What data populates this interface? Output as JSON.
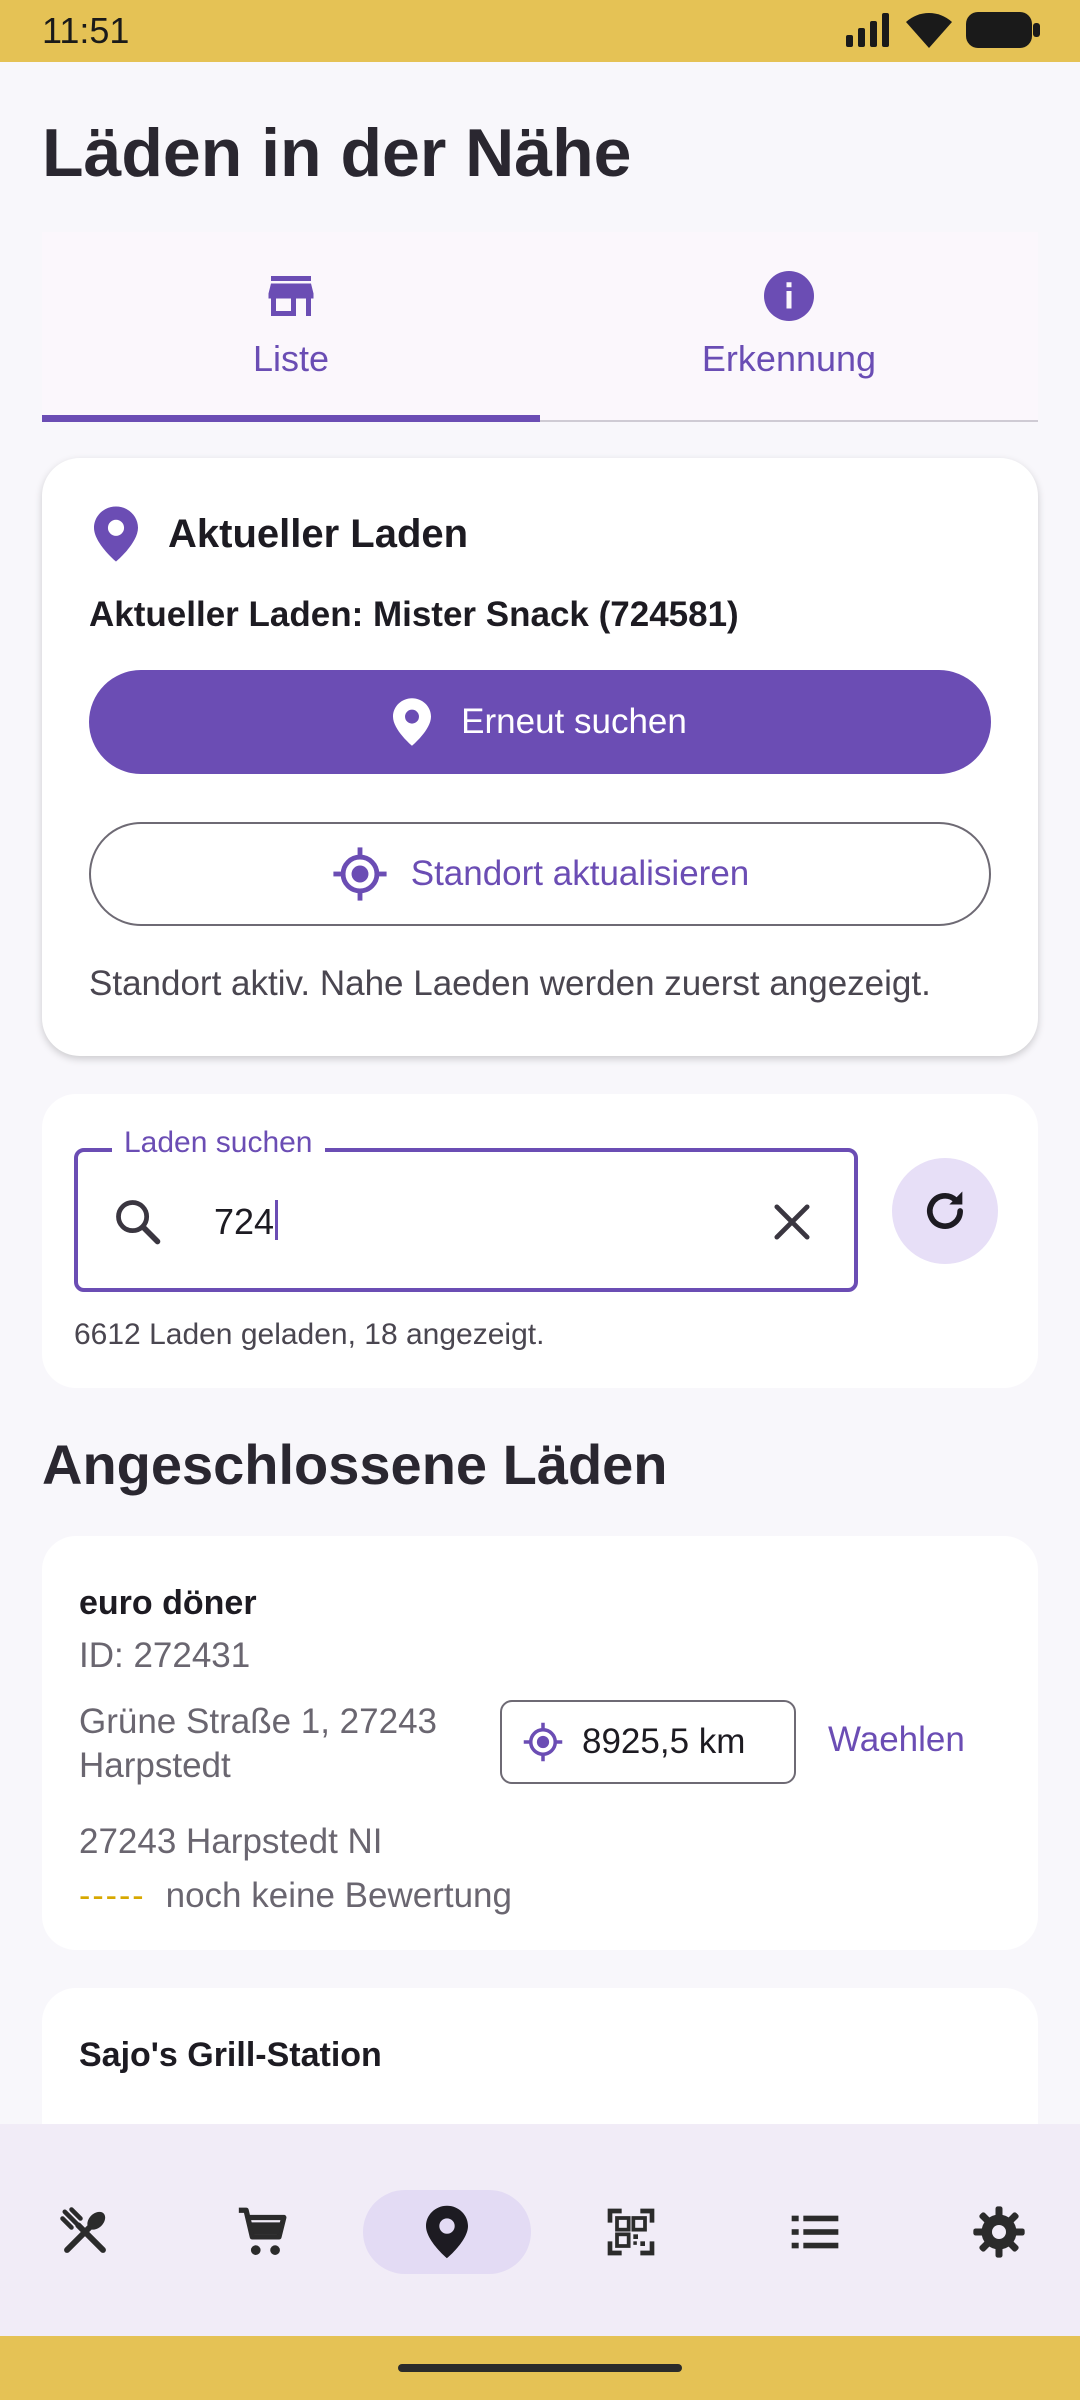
{
  "status_bar": {
    "time": "11:51"
  },
  "page": {
    "title": "Läden in der Nähe"
  },
  "tabs": [
    {
      "label": "Liste",
      "icon": "store-icon",
      "selected": true
    },
    {
      "label": "Erkennung",
      "icon": "info-icon",
      "selected": false
    }
  ],
  "current_store": {
    "heading": "Aktueller Laden",
    "subtitle": "Aktueller Laden: Mister Snack (724581)",
    "search_again_label": "Erneut suchen",
    "update_location_label": "Standort aktualisieren",
    "status_text": "Standort aktiv. Nahe Laeden werden zuerst angezeigt."
  },
  "search": {
    "label": "Laden suchen",
    "value": "724",
    "meta": "6612 Laden geladen, 18 angezeigt."
  },
  "section_title": "Angeschlossene Läden",
  "stores": [
    {
      "name": "euro döner",
      "id_text": "ID: 272431",
      "address": "Grüne Straße 1, 27243 Harpstedt",
      "distance": "8925,5 km",
      "choose_label": "Waehlen",
      "city": "27243 Harpstedt NI",
      "stars": "-----",
      "rating": "noch keine Bewertung"
    },
    {
      "name": "Sajo's Grill-Station"
    }
  ],
  "bottom_nav": [
    {
      "icon": "restaurant-icon",
      "active": false
    },
    {
      "icon": "cart-icon",
      "active": false
    },
    {
      "icon": "location-pin-icon",
      "active": true
    },
    {
      "icon": "qr-code-icon",
      "active": false
    },
    {
      "icon": "list-icon",
      "active": false
    },
    {
      "icon": "settings-icon",
      "active": false
    }
  ],
  "colors": {
    "accent": "#6b4db4",
    "status_bar": "#e5c255",
    "background": "#f8f7fb",
    "card": "#ffffff",
    "rating_star": "#d7a800"
  }
}
